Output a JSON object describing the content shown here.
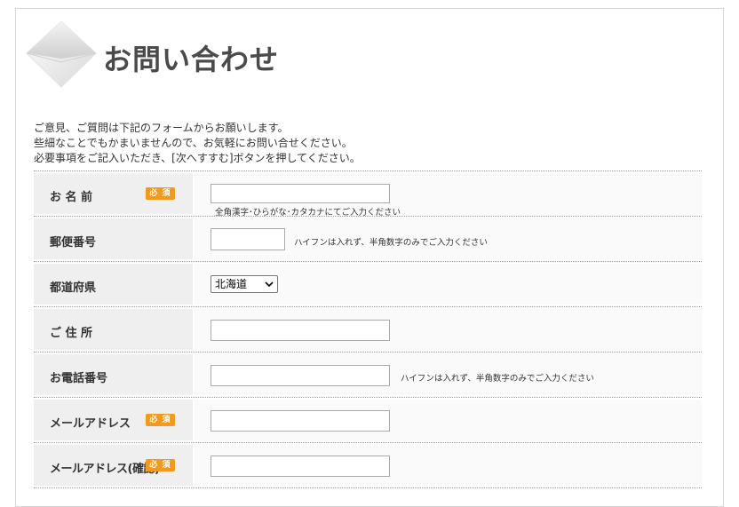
{
  "page": {
    "title": "お問い合わせ",
    "intro": [
      "ご意見、ご質問は下記のフォームからお願いします。",
      "些細なことでもかまいませんので、お気軽にお問い合せください。",
      "必要事項をご記入いただき、[次へすすむ]ボタンを押してください。"
    ]
  },
  "required_badge": "必 須",
  "fields": {
    "name": {
      "label": "お 名 前",
      "value": "",
      "hint": "全角漢字･ひらがな･カタカナにてご入力ください"
    },
    "postal": {
      "label": "郵便番号",
      "value": "",
      "hint": "ハイフンは入れず、半角数字のみでご入力ください"
    },
    "prefecture": {
      "label": "都道府県",
      "selected": "北海道"
    },
    "address": {
      "label": "ご 住 所",
      "value": ""
    },
    "phone": {
      "label": "お電話番号",
      "value": "",
      "hint": "ハイフンは入れず、半角数字のみでご入力ください"
    },
    "email": {
      "label": "メールアドレス",
      "value": ""
    },
    "email_confirm": {
      "label": "メールアドレス(確認)",
      "value": ""
    }
  },
  "colors": {
    "required": "#f39a1c",
    "label_bg": "#efefef",
    "title": "#4a4a4a"
  }
}
